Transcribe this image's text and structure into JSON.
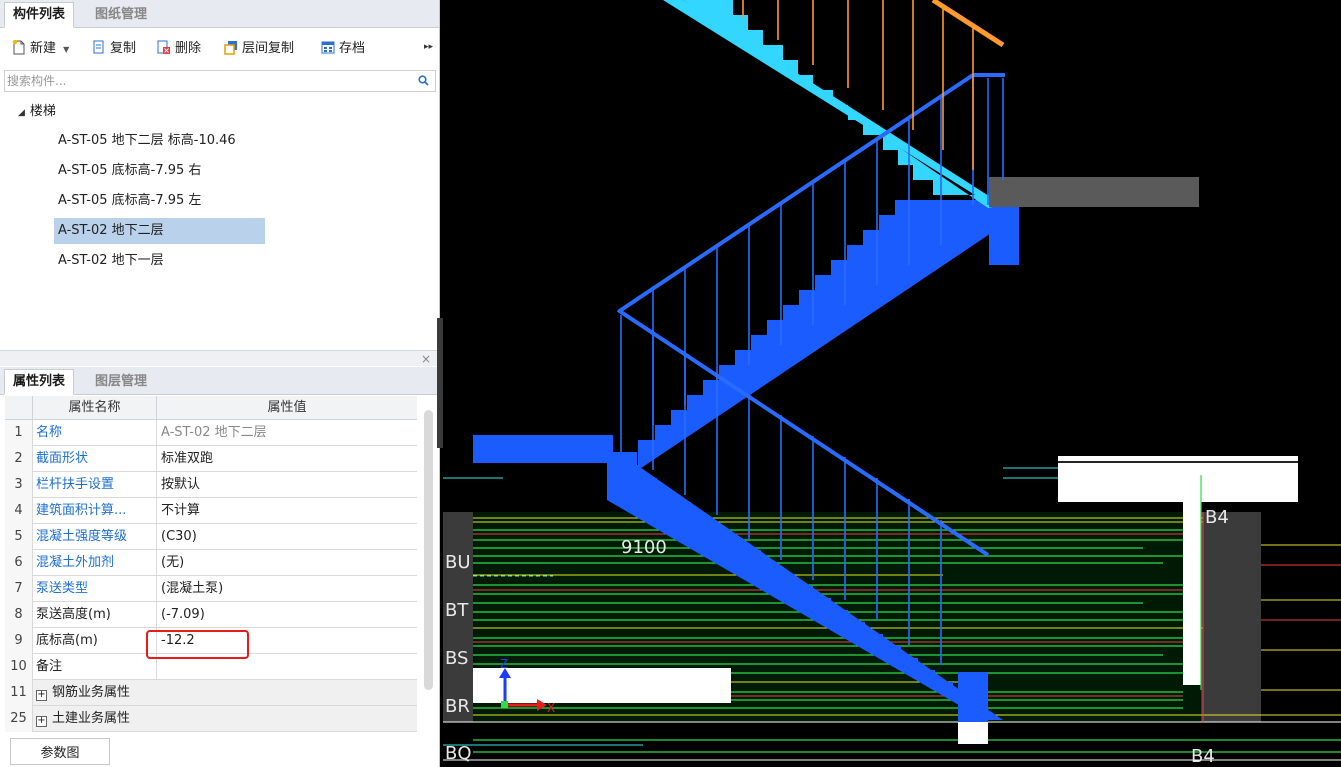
{
  "left_tabs": [
    "构件列表",
    "图纸管理"
  ],
  "toolbar": {
    "new": "新建",
    "copy": "复制",
    "delete": "删除",
    "floor_copy": "层间复制",
    "archive": "存档"
  },
  "search": {
    "placeholder": "搜索构件..."
  },
  "tree": {
    "root": "楼梯",
    "items": [
      "A-ST-05 地下二层 标高-10.46",
      "A-ST-05  底标高-7.95 右",
      "A-ST-05  底标高-7.95 左",
      "A-ST-02 地下二层",
      "A-ST-02 地下一层"
    ],
    "selected_index": 3
  },
  "prop_tabs": [
    "属性列表",
    "图层管理"
  ],
  "prop_headers": {
    "name": "属性名称",
    "value": "属性值"
  },
  "props": [
    {
      "num": "1",
      "name": "名称",
      "value": "A-ST-02 地下二层"
    },
    {
      "num": "2",
      "name": "截面形状",
      "value": "标准双跑"
    },
    {
      "num": "3",
      "name": "栏杆扶手设置",
      "value": "按默认"
    },
    {
      "num": "4",
      "name": "建筑面积计算...",
      "value": "不计算"
    },
    {
      "num": "5",
      "name": "混凝土强度等级",
      "value": "(C30)"
    },
    {
      "num": "6",
      "name": "混凝土外加剂",
      "value": "(无)"
    },
    {
      "num": "7",
      "name": "泵送类型",
      "value": "(混凝土泵)"
    },
    {
      "num": "8",
      "name": "泵送高度(m)",
      "value": "(-7.09)"
    },
    {
      "num": "9",
      "name": "底标高(m)",
      "value": "-12.2"
    },
    {
      "num": "10",
      "name": "备注",
      "value": ""
    },
    {
      "num": "11",
      "name": "钢筋业务属性",
      "value": ""
    },
    {
      "num": "25",
      "name": "土建业务属性",
      "value": ""
    }
  ],
  "param_button": "参数图",
  "viewport": {
    "dimension_label": "9100",
    "axis_labels_left": [
      "BU",
      "BT",
      "BS",
      "BR",
      "BQ"
    ],
    "axis_labels_right": [
      "B4",
      "B4"
    ],
    "axis_z": "Z",
    "axis_x": "X",
    "colors": {
      "stair_lower": "#1a5cff",
      "stair_upper": "#33d6ff",
      "railing_upper": "#ff9a2e",
      "grid_yellow": "#e5e52a",
      "grid_green": "#2edb4a"
    }
  }
}
